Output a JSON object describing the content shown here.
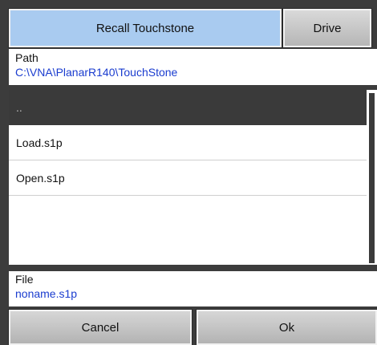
{
  "header": {
    "title_label": "Recall Touchstone",
    "drive_label": "Drive"
  },
  "path": {
    "label": "Path",
    "value": "C:\\VNA\\PlanarR140\\TouchStone"
  },
  "file_list": {
    "items": [
      {
        "label": ".."
      },
      {
        "label": "Load.s1p"
      },
      {
        "label": "Open.s1p"
      }
    ]
  },
  "file": {
    "label": "File",
    "value": "noname.s1p"
  },
  "footer": {
    "cancel_label": "Cancel",
    "ok_label": "Ok"
  },
  "colors": {
    "title_bg": "#a9cbf0",
    "value_text": "#1a3ccf",
    "selected_bg": "#3a3a3a"
  }
}
